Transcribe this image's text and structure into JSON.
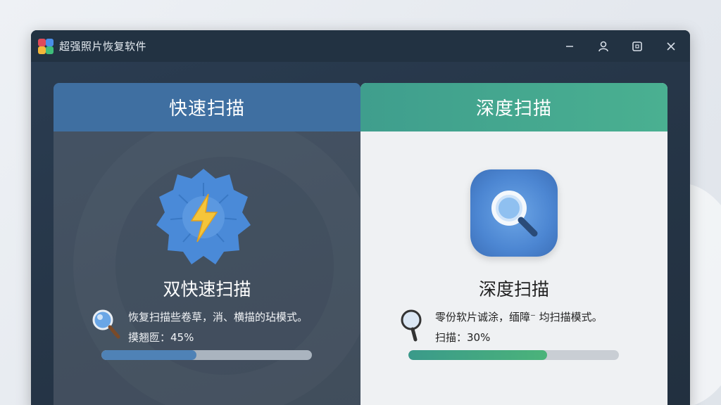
{
  "window": {
    "title": "超强照片恢复软件",
    "controls": {
      "minimize_icon": "minimize-icon",
      "account_icon": "user-icon",
      "maximize_icon": "maximize-icon",
      "close_icon": "close-icon"
    }
  },
  "quick_scan": {
    "header": "快速扫描",
    "mode_title": "双快速扫描",
    "description": "恢复扫描些卷草，消、横描的玷模式。",
    "progress_label": "摸翘匢：45%",
    "progress": 0.45,
    "icon": "lightning-gear-icon",
    "accent": "#3f6fa1"
  },
  "deep_scan": {
    "header": "深度扫描",
    "mode_title": "深度扫描",
    "description": "零份软片诚涂，缅障⁻ 均扫描模式。",
    "progress_label": "扫描：30%",
    "progress": 0.66,
    "icon": "magnifier-icon",
    "accent": "#4ab091"
  }
}
